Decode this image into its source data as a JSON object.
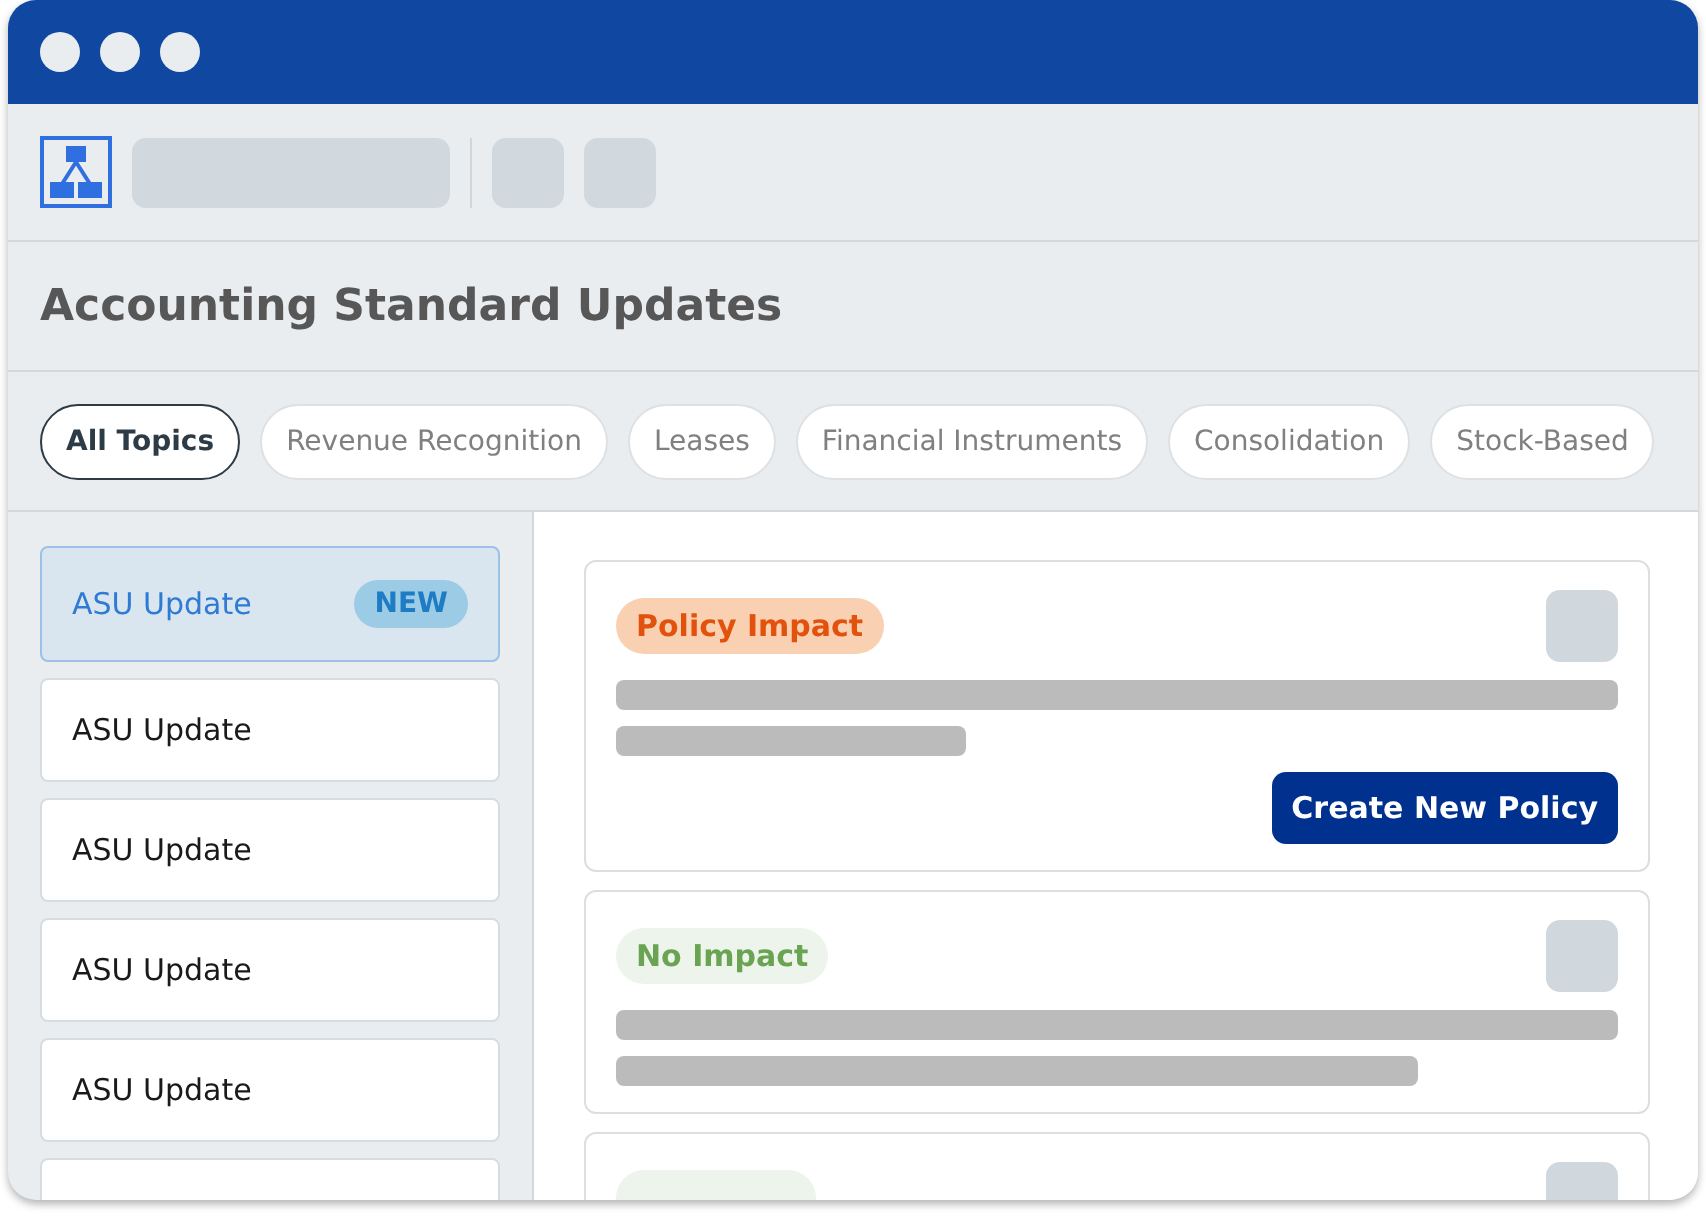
{
  "page": {
    "title": "Accounting Standard Updates"
  },
  "topics": [
    {
      "label": "All Topics",
      "selected": true
    },
    {
      "label": "Revenue Recognition",
      "selected": false
    },
    {
      "label": "Leases",
      "selected": false
    },
    {
      "label": "Financial Instruments",
      "selected": false
    },
    {
      "label": "Consolidation",
      "selected": false
    },
    {
      "label": "Stock-Based",
      "selected": false
    }
  ],
  "updates": [
    {
      "label": "ASU Update",
      "selected": true,
      "badge": "NEW"
    },
    {
      "label": "ASU Update",
      "selected": false
    },
    {
      "label": "ASU Update",
      "selected": false
    },
    {
      "label": "ASU Update",
      "selected": false
    },
    {
      "label": "ASU Update",
      "selected": false
    },
    {
      "selected": false
    }
  ],
  "cards": [
    {
      "kind": "policy",
      "tag": "Policy Impact",
      "button": "Create New Policy"
    },
    {
      "kind": "none",
      "tag": "No Impact"
    },
    {
      "kind": "none"
    }
  ]
}
